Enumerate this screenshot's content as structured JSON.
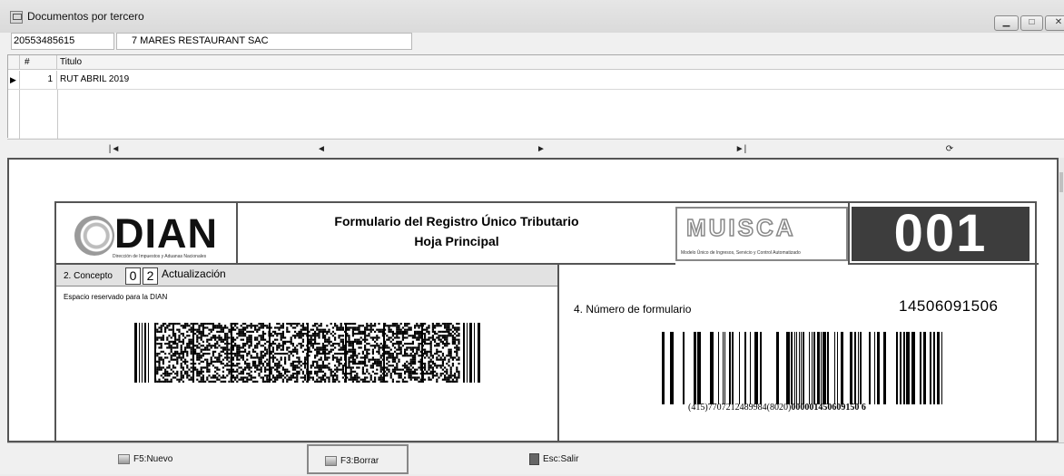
{
  "window": {
    "title": "Documentos por tercero"
  },
  "tercero": {
    "id": "20553485615",
    "name": "7 MARES RESTAURANT SAC"
  },
  "grid": {
    "columns": [
      "#",
      "Titulo"
    ],
    "rows": [
      {
        "num": "1",
        "title": "RUT ABRIL 2019"
      }
    ]
  },
  "navigator": {
    "first": "|◄",
    "prev": "◄",
    "next": "►",
    "last": "►|",
    "refresh": "⟳"
  },
  "document": {
    "logo": "DIAN",
    "logo_sub": "Dirección de Impuestos y Aduanas Nacionales",
    "title_line1": "Formulario del Registro Único Tributario",
    "title_line2": "Hoja Principal",
    "musica_logo": "MUISCA",
    "musica_sub": "Modelo Único de Ingresos, Servicio y Control Automatizado",
    "form_code": "001",
    "concept_label": "2. Concepto",
    "concept_digit1": "0",
    "concept_digit2": "2",
    "concept_text": "Actualización",
    "reserved_label": "Espacio reservado para la DIAN",
    "numero_label": "4. Número de formulario",
    "numero_value": "14506091506",
    "barcode_text_plain": "(415)7707212489984(8020)",
    "barcode_text_bold": "000001450609150 6"
  },
  "toolbar": {
    "nuevo": "F5:Nuevo",
    "borrar": "F3:Borrar",
    "salir": "Esc:Salir"
  }
}
